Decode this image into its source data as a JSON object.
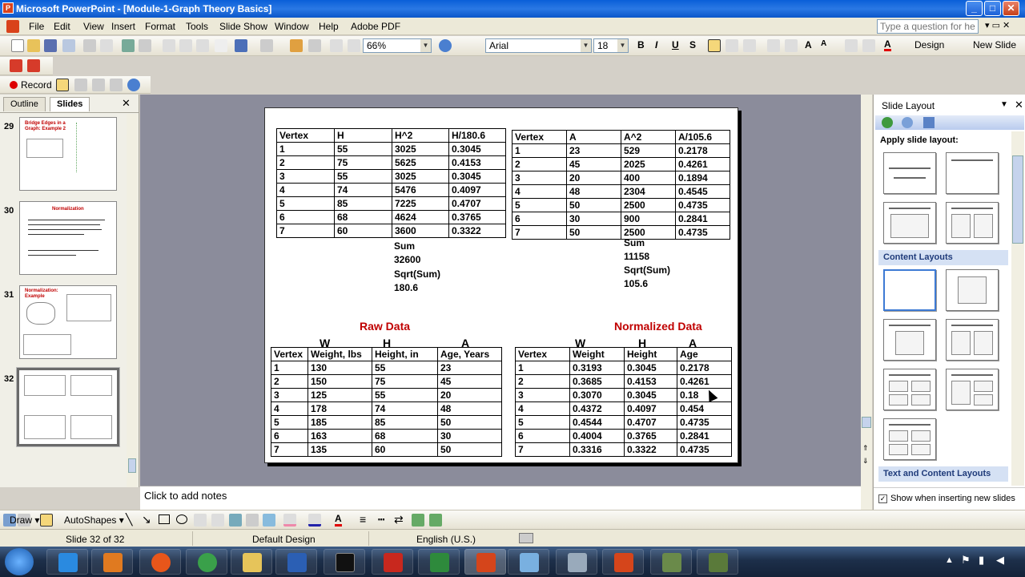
{
  "window": {
    "title": "Microsoft PowerPoint - [Module-1-Graph Theory Basics]"
  },
  "menu": {
    "items": [
      "File",
      "Edit",
      "View",
      "Insert",
      "Format",
      "Tools",
      "Slide Show",
      "Window",
      "Help",
      "Adobe PDF"
    ],
    "help_placeholder": "Type a question for help"
  },
  "toolbar": {
    "zoom": "66%",
    "font": "Arial",
    "size": "18",
    "design_label": "Design",
    "new_slide_label": "New Slide",
    "record_label": "Record"
  },
  "left_panel": {
    "tabs": [
      "Outline",
      "Slides"
    ],
    "slides": [
      {
        "num": "29",
        "title": "Bridge Edges in a Graph: Example 2"
      },
      {
        "num": "30",
        "title": "Normalization"
      },
      {
        "num": "31",
        "title": "Normalization: Example"
      },
      {
        "num": "32",
        "title": ""
      }
    ]
  },
  "slide": {
    "table_h": {
      "header": [
        "Vertex",
        "H",
        "H^2",
        "H/180.6"
      ],
      "rows": [
        [
          "1",
          "55",
          "3025",
          "0.3045"
        ],
        [
          "2",
          "75",
          "5625",
          "0.4153"
        ],
        [
          "3",
          "55",
          "3025",
          "0.3045"
        ],
        [
          "4",
          "74",
          "5476",
          "0.4097"
        ],
        [
          "5",
          "85",
          "7225",
          "0.4707"
        ],
        [
          "6",
          "68",
          "4624",
          "0.3765"
        ],
        [
          "7",
          "60",
          "3600",
          "0.3322"
        ]
      ],
      "sum_label": "Sum",
      "sum": "32600",
      "sqrt_label": "Sqrt(Sum)",
      "sqrt": "180.6"
    },
    "table_a": {
      "header": [
        "Vertex",
        "A",
        "A^2",
        "A/105.6"
      ],
      "rows": [
        [
          "1",
          "23",
          "529",
          "0.2178"
        ],
        [
          "2",
          "45",
          "2025",
          "0.4261"
        ],
        [
          "3",
          "20",
          "400",
          "0.1894"
        ],
        [
          "4",
          "48",
          "2304",
          "0.4545"
        ],
        [
          "5",
          "50",
          "2500",
          "0.4735"
        ],
        [
          "6",
          "30",
          "900",
          "0.2841"
        ],
        [
          "7",
          "50",
          "2500",
          "0.4735"
        ]
      ],
      "sum_label": "Sum",
      "sum": "11158",
      "sqrt_label": "Sqrt(Sum)",
      "sqrt": "105.6"
    },
    "raw": {
      "title": "Raw Data",
      "col_letters": [
        "W",
        "H",
        "A"
      ],
      "header": [
        "Vertex",
        "Weight, lbs",
        "Height, in",
        "Age, Years"
      ],
      "rows": [
        [
          "1",
          "130",
          "55",
          "23"
        ],
        [
          "2",
          "150",
          "75",
          "45"
        ],
        [
          "3",
          "125",
          "55",
          "20"
        ],
        [
          "4",
          "178",
          "74",
          "48"
        ],
        [
          "5",
          "185",
          "85",
          "50"
        ],
        [
          "6",
          "163",
          "68",
          "30"
        ],
        [
          "7",
          "135",
          "60",
          "50"
        ]
      ]
    },
    "normalized": {
      "title": "Normalized Data",
      "col_letters": [
        "W",
        "H",
        "A"
      ],
      "header": [
        "Vertex",
        "Weight",
        "Height",
        "Age"
      ],
      "rows": [
        [
          "1",
          "0.3193",
          "0.3045",
          "0.2178"
        ],
        [
          "2",
          "0.3685",
          "0.4153",
          "0.4261"
        ],
        [
          "3",
          "0.3070",
          "0.3045",
          "0.18"
        ],
        [
          "4",
          "0.4372",
          "0.4097",
          "0.454"
        ],
        [
          "5",
          "0.4544",
          "0.4707",
          "0.4735"
        ],
        [
          "6",
          "0.4004",
          "0.3765",
          "0.2841"
        ],
        [
          "7",
          "0.3316",
          "0.3322",
          "0.4735"
        ]
      ]
    }
  },
  "notes": {
    "placeholder": "Click to add notes"
  },
  "task_pane": {
    "title": "Slide Layout",
    "apply_label": "Apply slide layout:",
    "section_content": "Content Layouts",
    "section_text_content": "Text and Content Layouts",
    "show_label": "Show when inserting new slides"
  },
  "drawbar": {
    "draw_label": "Draw",
    "autoshapes_label": "AutoShapes"
  },
  "status": {
    "slide": "Slide 32 of 32",
    "design": "Default Design",
    "language": "English (U.S.)"
  },
  "colors": {
    "accent_red": "#c00000",
    "title_blue": "#0a5fd8"
  }
}
